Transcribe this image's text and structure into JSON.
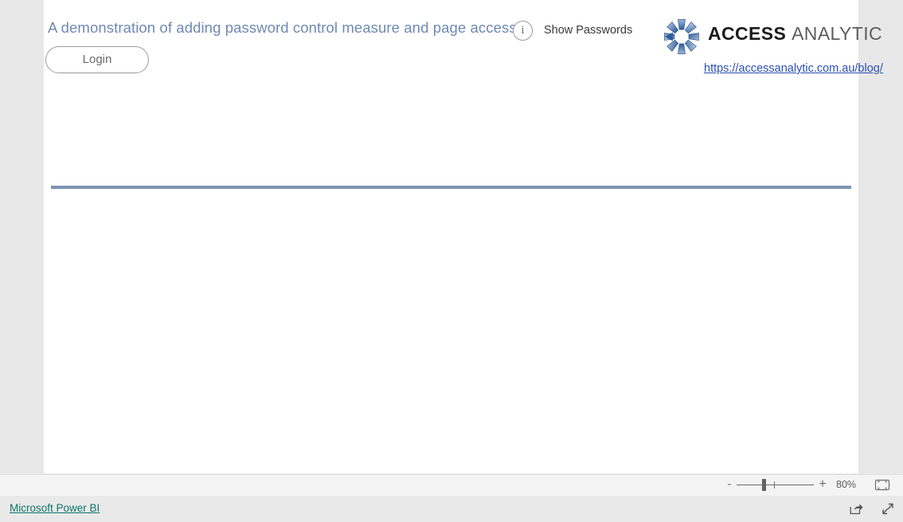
{
  "report": {
    "title": "A demonstration of adding password control measure and page access",
    "login_button_label": "Login",
    "show_passwords_label": "Show Passwords",
    "info_icon_glyph": "i",
    "divider_color": "#7d93b2",
    "title_color": "#6f89b5"
  },
  "logo": {
    "wordmark_bold": "ACCESS",
    "wordmark_light": "ANALYTIC",
    "url": "https://accessanalytic.com.au/blog/",
    "url_color": "#2c50b4",
    "mark_colors": {
      "dark": "#2f5c99",
      "mid": "#4a7ab5",
      "light": "#93b2d2",
      "pale": "#b9cde1"
    }
  },
  "zoom_bar": {
    "minus_label": "-",
    "plus_label": "+",
    "zoom_level": "80%",
    "fit_icon": "fit-to-page-icon",
    "slider_value": 33
  },
  "status_bar": {
    "brand_link": "Microsoft Power BI",
    "brand_link_color": "#0e7569",
    "share_icon": "share-icon",
    "fullscreen_icon": "fullscreen-icon"
  }
}
